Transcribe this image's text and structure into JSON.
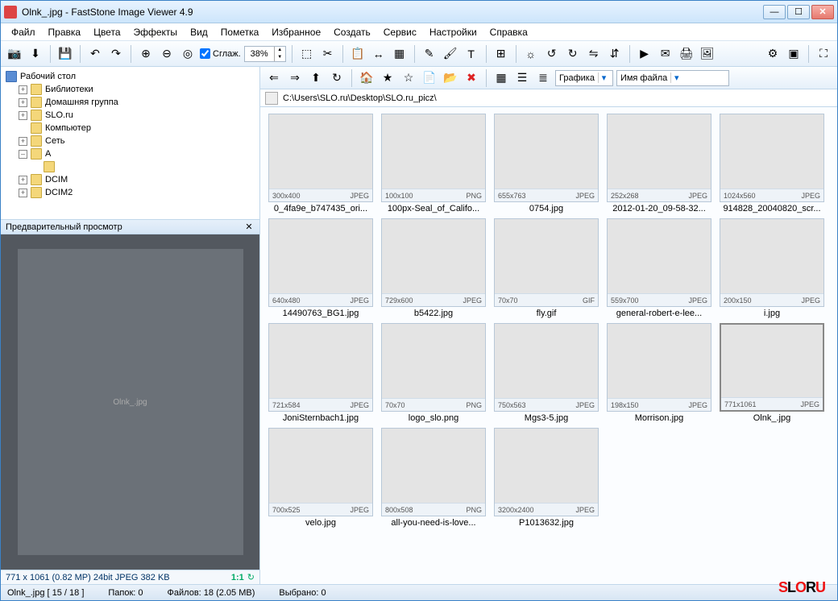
{
  "window": {
    "title": "Olnk_.jpg  -  FastStone Image Viewer 4.9"
  },
  "menu": [
    "Файл",
    "Правка",
    "Цвета",
    "Эффекты",
    "Вид",
    "Пометка",
    "Избранное",
    "Создать",
    "Сервис",
    "Настройки",
    "Справка"
  ],
  "toolbar": {
    "smoothing_label": "Сглаж.",
    "zoom_value": "38%"
  },
  "tree": {
    "root": "Рабочий стол",
    "items": [
      {
        "exp": "+",
        "ico": "lib",
        "label": "Библиотеки",
        "level": 1
      },
      {
        "exp": "+",
        "ico": "grp",
        "label": "Домашняя группа",
        "level": 1
      },
      {
        "exp": "+",
        "ico": "usr",
        "label": "SLO.ru",
        "level": 1
      },
      {
        "exp": "",
        "ico": "pc",
        "label": "Компьютер",
        "level": 1
      },
      {
        "exp": "+",
        "ico": "net",
        "label": "Сеть",
        "level": 1
      },
      {
        "exp": "–",
        "ico": "fld",
        "label": "A",
        "level": 1
      },
      {
        "exp": "",
        "ico": "fld",
        "label": "",
        "level": 2
      },
      {
        "exp": "+",
        "ico": "fld",
        "label": "DCIM",
        "level": 1
      },
      {
        "exp": "+",
        "ico": "fld",
        "label": "DCIM2",
        "level": 1
      }
    ]
  },
  "preview": {
    "header": "Предварительный просмотр",
    "info": "771 x 1061 (0.82 MP)  24bit  JPEG  382 KB",
    "ratio": "1:1"
  },
  "nav": {
    "view_label": "Графика",
    "sort_label": "Имя файла",
    "path": "C:\\Users\\SLO.ru\\Desktop\\SLO.ru_picz\\"
  },
  "thumbs": [
    {
      "dim": "300x400",
      "fmt": "JPEG",
      "name": "0_4fa9e_b747435_ori..."
    },
    {
      "dim": "100x100",
      "fmt": "PNG",
      "name": "100px-Seal_of_Califo..."
    },
    {
      "dim": "655x763",
      "fmt": "JPEG",
      "name": "0754.jpg"
    },
    {
      "dim": "252x268",
      "fmt": "JPEG",
      "name": "2012-01-20_09-58-32..."
    },
    {
      "dim": "1024x560",
      "fmt": "JPEG",
      "name": "914828_20040820_scr..."
    },
    {
      "dim": "640x480",
      "fmt": "JPEG",
      "name": "14490763_BG1.jpg"
    },
    {
      "dim": "729x600",
      "fmt": "JPEG",
      "name": "b5422.jpg"
    },
    {
      "dim": "70x70",
      "fmt": "GIF",
      "name": "fly.gif"
    },
    {
      "dim": "559x700",
      "fmt": "JPEG",
      "name": "general-robert-e-lee..."
    },
    {
      "dim": "200x150",
      "fmt": "JPEG",
      "name": "i.jpg"
    },
    {
      "dim": "721x584",
      "fmt": "JPEG",
      "name": "JoniSternbach1.jpg"
    },
    {
      "dim": "70x70",
      "fmt": "PNG",
      "name": "logo_slo.png"
    },
    {
      "dim": "750x563",
      "fmt": "JPEG",
      "name": "Mgs3-5.jpg"
    },
    {
      "dim": "198x150",
      "fmt": "JPEG",
      "name": "Morrison.jpg"
    },
    {
      "dim": "771x1061",
      "fmt": "JPEG",
      "name": "Olnk_.jpg",
      "selected": true
    },
    {
      "dim": "700x525",
      "fmt": "JPEG",
      "name": "velo.jpg"
    },
    {
      "dim": "800x508",
      "fmt": "PNG",
      "name": "all-you-need-is-love..."
    },
    {
      "dim": "3200x2400",
      "fmt": "JPEG",
      "name": "P1013632.jpg"
    }
  ],
  "status": {
    "file": "Olnk_.jpg [ 15 / 18 ]",
    "folders": "Папок: 0",
    "files": "Файлов: 18 (2.05 МВ)",
    "selected": "Выбрано: 0"
  }
}
